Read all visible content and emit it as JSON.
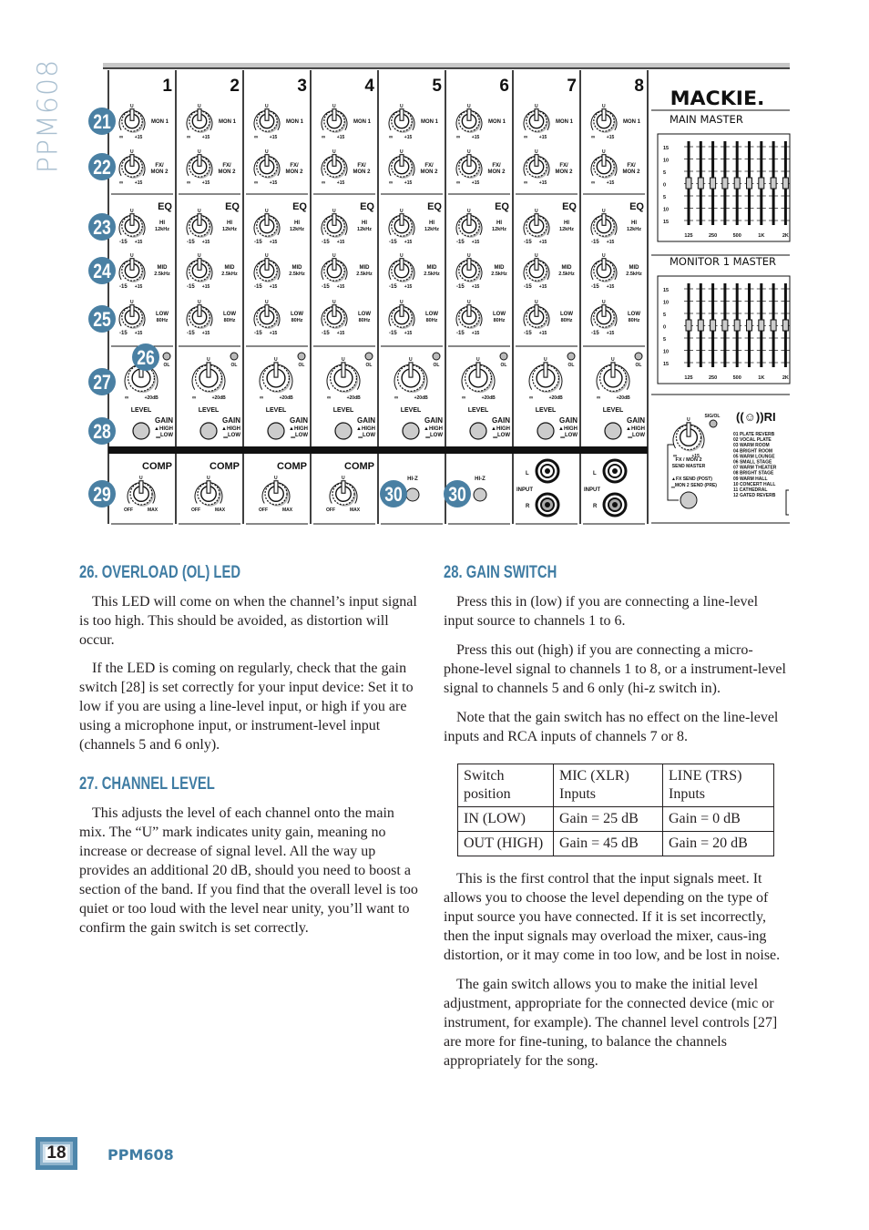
{
  "side_title": "PPM608",
  "diagram": {
    "channels": [
      "1",
      "2",
      "3",
      "4",
      "5",
      "6",
      "7",
      "8"
    ],
    "mon1": "MON 1",
    "fx_mon2": [
      "FX/",
      "MON 2"
    ],
    "knob_min": "∞",
    "knob_max": "+15",
    "unity": "U",
    "eq": "EQ",
    "eq_min": "-15",
    "eq_max": "+15",
    "hi": [
      "HI",
      "12kHz"
    ],
    "mid": [
      "MID",
      "2.5kHz"
    ],
    "low": [
      "LOW",
      "80Hz"
    ],
    "ol": "OL",
    "level": "LEVEL",
    "level_max": "+20dB",
    "gain": "GAIN",
    "gain_high": "HIGH",
    "gain_low": "LOW",
    "comp": "COMP",
    "comp_min": "OFF",
    "comp_max": "MAX",
    "hiz": "HI-Z",
    "input": "INPUT",
    "left": "L",
    "right": "R",
    "brand": "MACKIE.",
    "main_master": "MAIN MASTER",
    "monitor_master": "MONITOR 1 MASTER",
    "eq_scale": [
      "15",
      "10",
      "5",
      "0",
      "5",
      "10",
      "15"
    ],
    "eq_freqs": [
      "125",
      "250",
      "500",
      "1K",
      "2K"
    ],
    "sig_ol": "SIG/OL",
    "send_master": [
      "FX / MON 2",
      "SEND MASTER"
    ],
    "fx_send": "FX SEND (POST)",
    "mon2_send": "MON 2 SEND (PRE)",
    "reverb_logo": "((☺))RI",
    "reverbs": [
      "01 PLATE REVERB",
      "02 VOCAL PLATE",
      "03 WARM ROOM",
      "04 BRIGHT ROOM",
      "05 WARM LOUNGE",
      "06 SMALL STAGE",
      "07 WARM THEATER",
      "08 BRIGHT STAGE",
      "09 WARM HALL",
      "10 CONCERT HALL",
      "11 CATHEDRAL",
      "12 GATED REVERB"
    ],
    "callouts": [
      "21",
      "22",
      "23",
      "24",
      "25",
      "26",
      "27",
      "28",
      "29",
      "30",
      "30"
    ],
    "callout_color": "#4a80a3"
  },
  "sections": {
    "s26": {
      "title": "26. OVERLOAD (OL) LED",
      "paras": [
        "This LED will come on when the channel’s input signal is too high. This should be avoided, as distortion will occur.",
        "If the LED is coming on regularly, check that the gain switch [28] is set correctly for your input device: Set it to low if you are using a line-level input, or high if you are using a microphone input, or instrument-level input (channels 5 and 6 only)."
      ]
    },
    "s27": {
      "title": "27. CHANNEL LEVEL",
      "paras": [
        "This adjusts the level of each channel onto the main mix. The “U” mark indicates unity gain, meaning no increase or decrease of signal level. All the way up provides an additional 20 dB, should you need to boost a section of the band. If you find that the overall level is too quiet or too loud with the level near unity, you’ll want to confirm the gain switch is set correctly."
      ]
    },
    "s28": {
      "title": "28. GAIN SWITCH",
      "paras": [
        "Press this in (low) if you are connecting a line-level input source to channels 1 to 6.",
        "Press this out (high) if you are connecting a micro-phone-level signal to channels 1 to 8, or a instrument-level signal to channels 5 and 6 only (hi-z switch in).",
        "Note that the gain switch has no effect on the line-level inputs and RCA inputs of channels 7 or 8."
      ],
      "paras_after": [
        "This is the first control that the input signals meet. It allows you to choose the level depending on the type of input source you have connected. If it is set incorrectly, then the input signals may overload the mixer, caus-ing distortion, or it may come in too low, and be lost in noise.",
        "The gain switch allows you to make the initial level adjustment, appropriate for the connected device (mic or instrument, for example). The channel level controls [27] are more for fine-tuning, to balance the channels appropriately for the song."
      ]
    }
  },
  "gain_table": {
    "header": [
      "Switch position",
      "MIC (XLR) Inputs",
      "LINE (TRS) Inputs"
    ],
    "rows": [
      [
        "IN (LOW)",
        "Gain = 25 dB",
        "Gain = 0 dB"
      ],
      [
        "OUT (HIGH)",
        "Gain = 45 dB",
        "Gain = 20 dB"
      ]
    ]
  },
  "footer": {
    "page_number": "18",
    "brand": "PPM608"
  }
}
